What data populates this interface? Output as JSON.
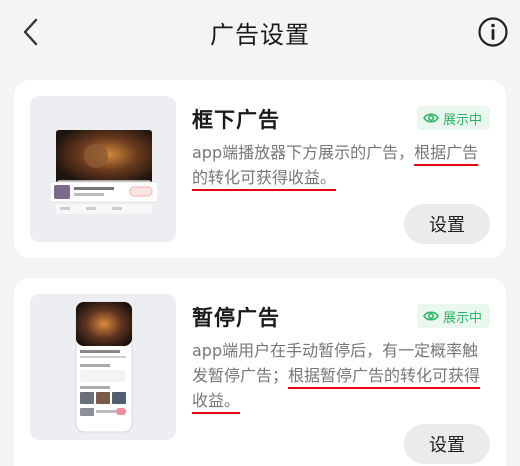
{
  "header": {
    "title": "广告设置",
    "back_icon": "chevron-left-icon",
    "info_icon": "info-circle-icon"
  },
  "ads": [
    {
      "title": "框下广告",
      "status": "展示中",
      "desc_plain": "app端播放器下方展示的广告，",
      "desc_highlight": "根据广告的转化可获得收益。",
      "button": "设置"
    },
    {
      "title": "暂停广告",
      "status": "展示中",
      "desc_plain": "app端用户在手动暂停后，有一定概率触发暂停广告；",
      "desc_highlight": "根据暂停广告的转化可获得收益。",
      "button": "设置"
    }
  ],
  "colors": {
    "accent_green": "#2fb36a",
    "underline_red": "#e60012",
    "background": "#f4f4f4"
  }
}
